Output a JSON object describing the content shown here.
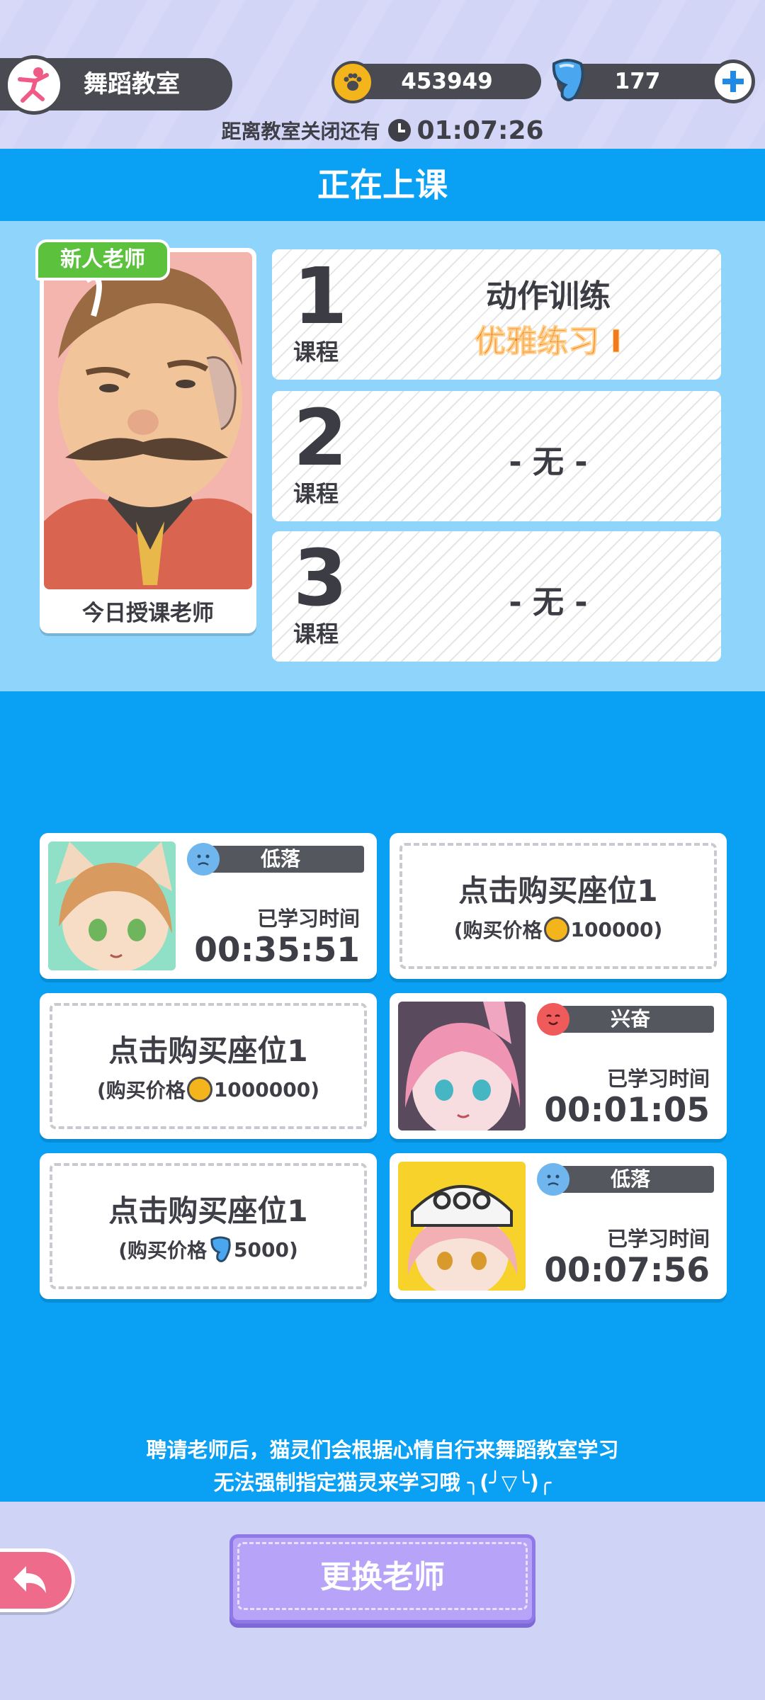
{
  "header": {
    "room_title": "舞蹈教室",
    "coins": "453949",
    "gems": "177",
    "close_label": "距离教室关闭还有",
    "close_time": "01:07:26"
  },
  "section_title": "正在上课",
  "teacher": {
    "badge": "新人老师",
    "label": "今日授课老师"
  },
  "courses": [
    {
      "number": "1",
      "word": "课程",
      "title": "动作训练",
      "subtitle": "优雅练习 I"
    },
    {
      "number": "2",
      "word": "课程",
      "title": "- 无 -"
    },
    {
      "number": "3",
      "word": "课程",
      "title": "- 无 -"
    }
  ],
  "seats": {
    "occupied": [
      {
        "mood": "低落",
        "study_label": "已学习时间",
        "study_time": "00:35:51",
        "mood_color": "#6fb6ee"
      },
      {
        "mood": "兴奋",
        "study_label": "已学习时间",
        "study_time": "00:01:05",
        "mood_color": "#ef5a5a"
      },
      {
        "mood": "低落",
        "study_label": "已学习时间",
        "study_time": "00:07:56",
        "mood_color": "#6fb6ee"
      }
    ],
    "empty": [
      {
        "title": "点击购买座位1",
        "price_prefix": "(购买价格",
        "price": "100000)",
        "currency": "paw-coin"
      },
      {
        "title": "点击购买座位1",
        "price_prefix": "(购买价格",
        "price": "1000000)",
        "currency": "paw-coin"
      },
      {
        "title": "点击购买座位1",
        "price_prefix": "(购买价格",
        "price": "5000)",
        "currency": "gem"
      }
    ]
  },
  "tips": {
    "line1": "聘请老师后，猫灵们会根据心情自行来舞蹈教室学习",
    "line2": "无法强制指定猫灵来学习哦 ╮(╯▽╰)╭"
  },
  "buttons": {
    "change_teacher": "更换老师"
  },
  "colors": {
    "main_blue": "#0aa0f3",
    "light_blue": "#8fd4fb",
    "coin_yellow": "#f3b51b",
    "new_badge_green": "#5cc13c",
    "orange_text": "#f07a1c",
    "purple_button": "#b7a3f7"
  }
}
